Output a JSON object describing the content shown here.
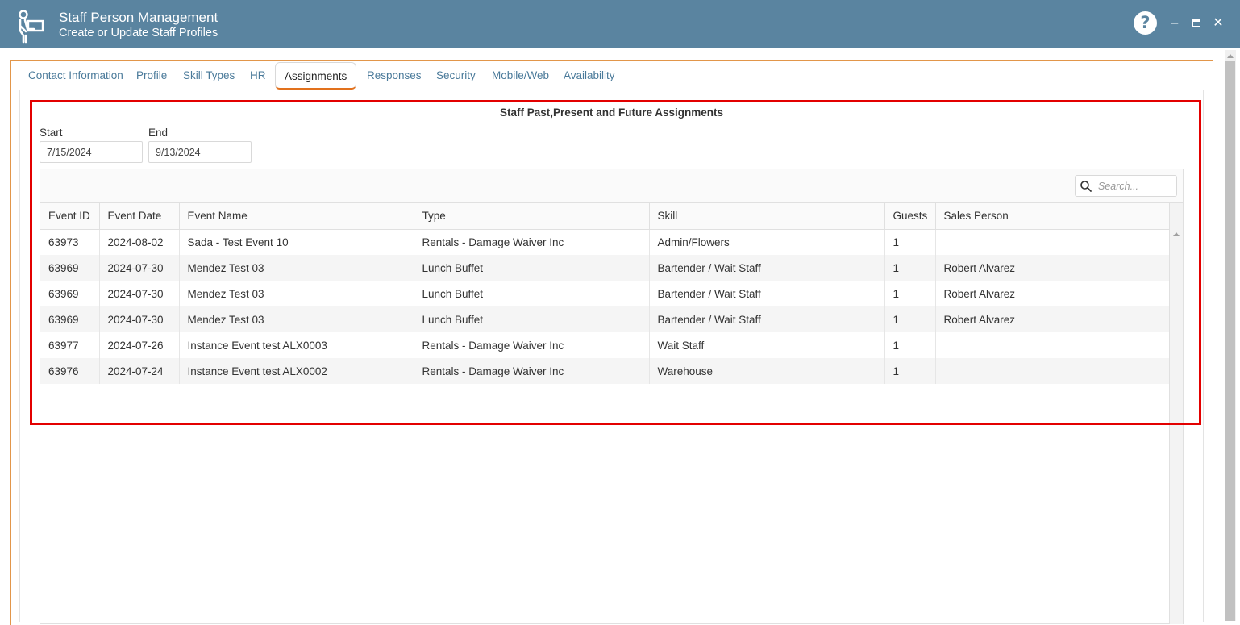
{
  "window": {
    "title": "Staff Person Management",
    "subtitle": "Create or Update Staff Profiles",
    "help_glyph": "?",
    "minimize_glyph": "–",
    "close_glyph": "✕"
  },
  "tabs": [
    {
      "label": "Contact Information",
      "active": false
    },
    {
      "label": "Profile",
      "active": false
    },
    {
      "label": "Skill Types",
      "active": false
    },
    {
      "label": "HR",
      "active": false
    },
    {
      "label": "Assignments",
      "active": true
    },
    {
      "label": "Responses",
      "active": false
    },
    {
      "label": "Security",
      "active": false
    },
    {
      "label": "Mobile/Web",
      "active": false
    },
    {
      "label": "Availability",
      "active": false
    }
  ],
  "assignments": {
    "title": "Staff Past,Present and Future Assignments",
    "start_label": "Start",
    "start_value": "7/15/2024",
    "end_label": "End",
    "end_value": "9/13/2024",
    "search_placeholder": "Search...",
    "columns": [
      "Event ID",
      "Event Date",
      "Event Name",
      "Type",
      "Skill",
      "Guests",
      "Sales Person"
    ],
    "rows": [
      [
        "63973",
        "2024-08-02",
        "Sada - Test Event 10",
        "Rentals - Damage Waiver Inc",
        "Admin/Flowers",
        "1",
        ""
      ],
      [
        "63969",
        "2024-07-30",
        "Mendez Test 03",
        "Lunch Buffet",
        "Bartender / Wait Staff",
        "1",
        "Robert Alvarez"
      ],
      [
        "63969",
        "2024-07-30",
        "Mendez Test 03",
        "Lunch Buffet",
        "Bartender / Wait Staff",
        "1",
        "Robert Alvarez"
      ],
      [
        "63969",
        "2024-07-30",
        "Mendez Test 03",
        "Lunch Buffet",
        "Bartender / Wait Staff",
        "1",
        "Robert Alvarez"
      ],
      [
        "63977",
        "2024-07-26",
        "Instance Event test ALX0003",
        "Rentals - Damage Waiver Inc",
        "Wait Staff",
        "1",
        ""
      ],
      [
        "63976",
        "2024-07-24",
        "Instance Event test ALX0002",
        "Rentals - Damage Waiver Inc",
        "Warehouse",
        "1",
        ""
      ]
    ]
  },
  "colors": {
    "titlebar": "#5a84a0",
    "tab_text": "#4a7a9a",
    "active_tab_underline": "#e2711d",
    "frame_border": "#e2964a",
    "highlight_box": "#e30000"
  },
  "icons": {
    "app": "staff-person-icon",
    "help": "help-icon",
    "search": "search-icon"
  }
}
